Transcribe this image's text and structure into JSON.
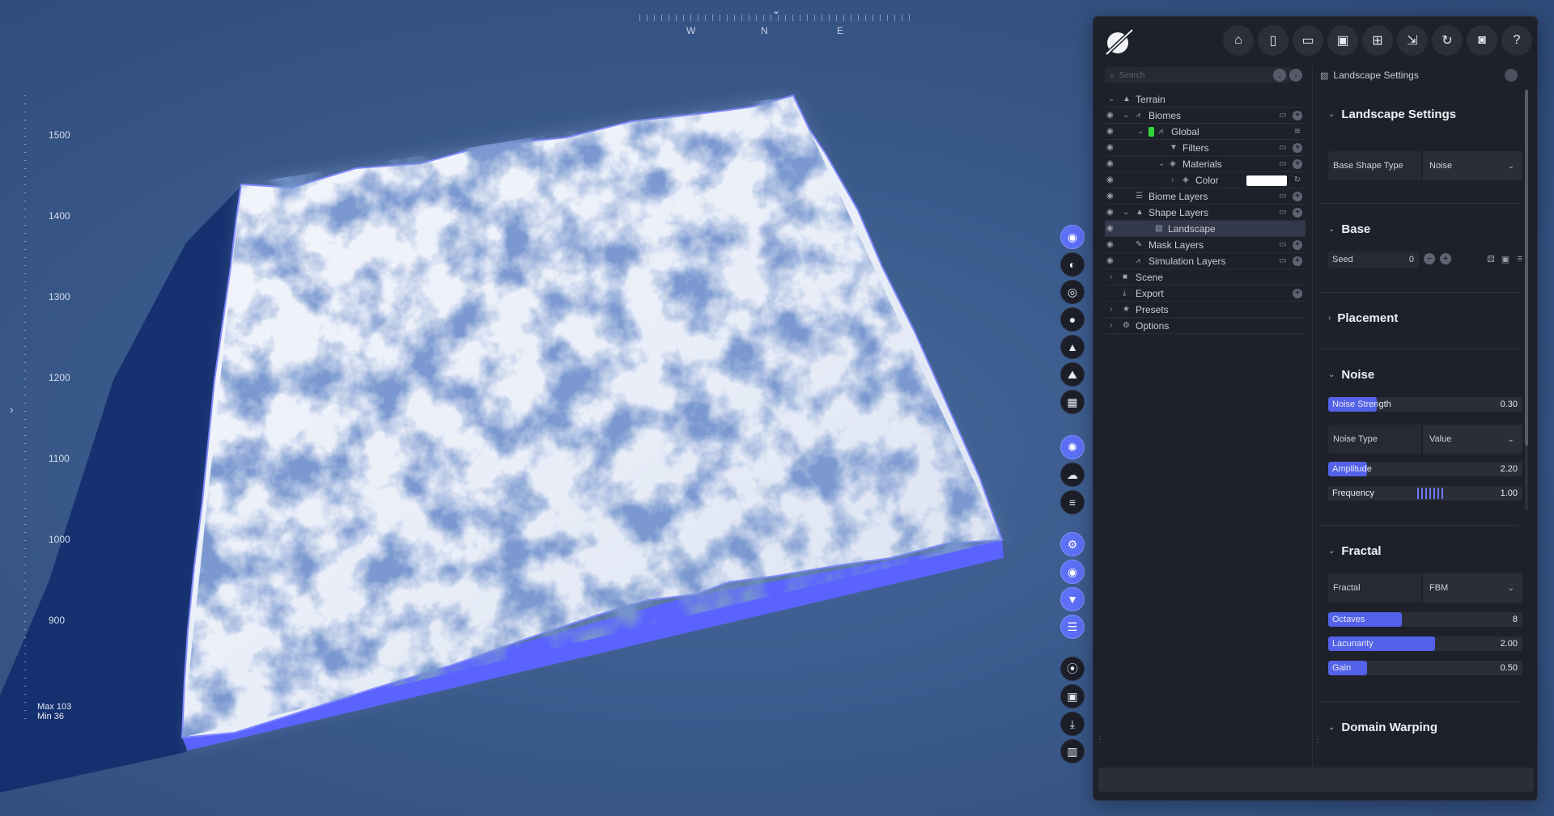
{
  "compass": {
    "marker": "⌄",
    "w": "W",
    "n": "N",
    "e": "E"
  },
  "ruler": {
    "labels": [
      "1500",
      "1400",
      "1300",
      "1200",
      "1100",
      "1000",
      "900"
    ]
  },
  "minmax": {
    "max": "Max 103",
    "min": "Min 36"
  },
  "toolbar": {
    "buttons": [
      "home-icon",
      "new-file-icon",
      "open-folder-icon",
      "save-icon",
      "save-as-icon",
      "export-icon",
      "refresh-icon",
      "camera-icon",
      "help-icon"
    ]
  },
  "search": {
    "placeholder": "Search"
  },
  "tree": {
    "terrain": "Terrain",
    "biomes": "Biomes",
    "global": "Global",
    "filters": "Filters",
    "materials": "Materials",
    "color": "Color",
    "biome_layers": "Biome Layers",
    "shape_layers": "Shape Layers",
    "landscape": "Landscape",
    "mask_layers": "Mask Layers",
    "simulation_layers": "Simulation Layers",
    "scene": "Scene",
    "export": "Export",
    "presets": "Presets",
    "options": "Options"
  },
  "settings": {
    "header": "Landscape Settings",
    "landscape_settings": {
      "title": "Landscape Settings",
      "base_shape_type_label": "Base Shape Type",
      "base_shape_type_value": "Noise"
    },
    "base": {
      "title": "Base",
      "seed_label": "Seed",
      "seed_value": "0"
    },
    "placement": {
      "title": "Placement"
    },
    "noise": {
      "title": "Noise",
      "noise_strength_label": "Noise Strength",
      "noise_strength_value": "0.30",
      "noise_strength_fraction": 0.25,
      "noise_type_label": "Noise Type",
      "noise_type_value": "Value",
      "amplitude_label": "Amplitude",
      "amplitude_value": "2.20",
      "amplitude_fraction": 0.2,
      "frequency_label": "Frequency",
      "frequency_value": "1.00"
    },
    "fractal": {
      "title": "Fractal",
      "fractal_label": "Fractal",
      "fractal_value": "FBM",
      "octaves_label": "Octaves",
      "octaves_value": "8",
      "octaves_fraction": 0.38,
      "lacunarity_label": "Lacunarity",
      "lacunarity_value": "2.00",
      "lacunarity_fraction": 0.55,
      "gain_label": "Gain",
      "gain_value": "0.50",
      "gain_fraction": 0.2
    },
    "domain_warping": {
      "title": "Domain Warping"
    }
  },
  "colors": {
    "accent": "#5c6ff5",
    "terrain_edge": "#5b63ff",
    "panel_bg": "#1e212a",
    "active_swatch": "#2fd63a"
  }
}
